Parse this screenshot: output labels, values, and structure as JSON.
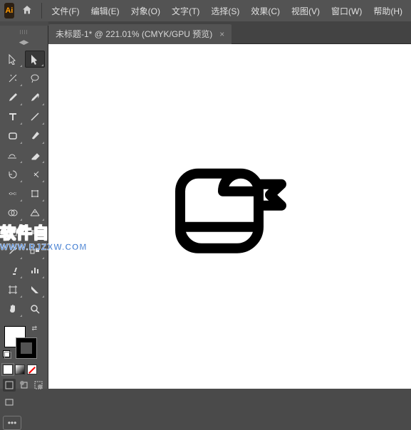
{
  "app": {
    "logo": "Ai"
  },
  "menu": [
    "文件(F)",
    "编辑(E)",
    "对象(O)",
    "文字(T)",
    "选择(S)",
    "效果(C)",
    "视图(V)",
    "窗口(W)",
    "帮助(H)"
  ],
  "tab": {
    "title": "未标题-1* @ 221.01% (CMYK/GPU 预览)",
    "close": "×"
  },
  "watermark": {
    "line1": "软件自学网",
    "line2": "WWW.RJZXW.COM"
  },
  "toolbox": {
    "collapse": "◀▶",
    "more": "•••"
  }
}
